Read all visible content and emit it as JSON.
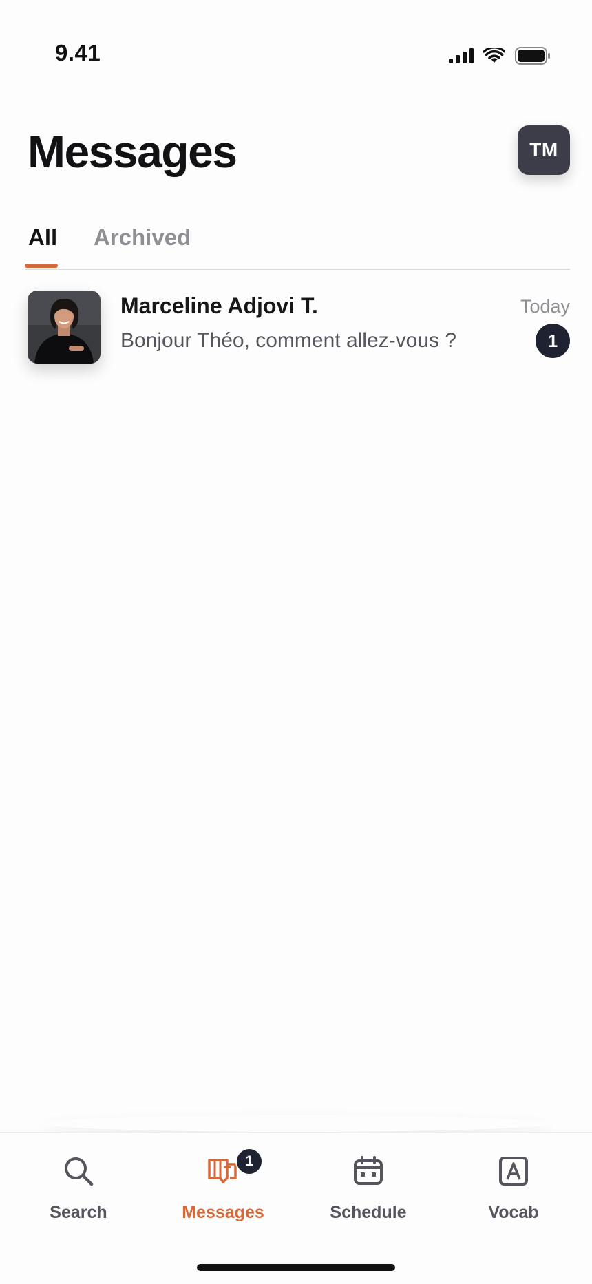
{
  "status_bar": {
    "time": "9.41",
    "icons": [
      "signal-icon",
      "wifi-icon",
      "battery-icon"
    ]
  },
  "header": {
    "title": "Messages",
    "avatar_initials": "TM"
  },
  "tabs": [
    {
      "label": "All",
      "active": true
    },
    {
      "label": "Archived",
      "active": false
    }
  ],
  "conversations": [
    {
      "name": "Marceline Adjovi T.",
      "preview": "Bonjour Théo, comment allez-vous ?",
      "time": "Today",
      "unread": "1"
    }
  ],
  "tabbar": {
    "items": [
      {
        "label": "Search",
        "icon": "search-icon",
        "active": false
      },
      {
        "label": "Messages",
        "icon": "messages-icon",
        "active": true,
        "badge": "1"
      },
      {
        "label": "Schedule",
        "icon": "calendar-icon",
        "active": false
      },
      {
        "label": "Vocab",
        "icon": "vocab-icon",
        "active": false
      }
    ]
  },
  "colors": {
    "accent": "#d4693a",
    "badge": "#1f2230",
    "avatar_bg": "#3d3d4a",
    "text_primary": "#121214",
    "text_secondary": "#8e8e95"
  }
}
